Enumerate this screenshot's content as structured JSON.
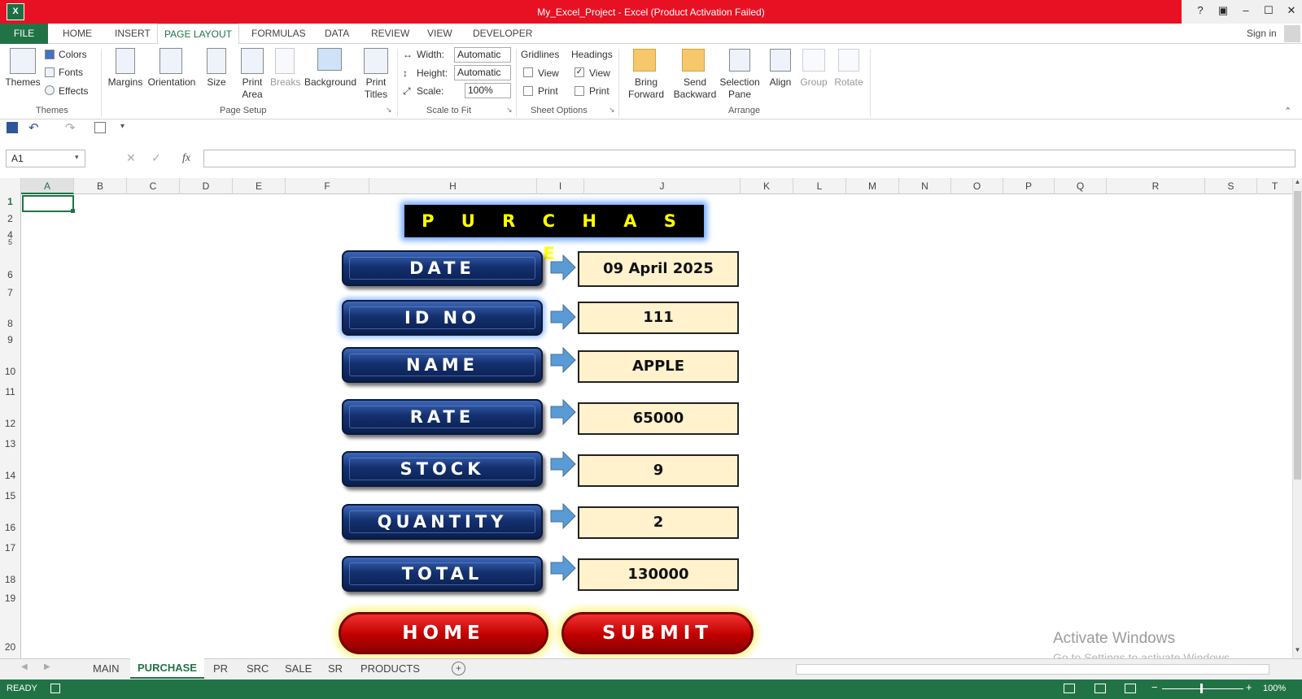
{
  "window": {
    "title": "My_Excel_Project -  Excel (Product Activation Failed)",
    "help": "?",
    "sign_in": "Sign in"
  },
  "ribbon_tabs": [
    "FILE",
    "HOME",
    "INSERT",
    "PAGE LAYOUT",
    "FORMULAS",
    "DATA",
    "REVIEW",
    "VIEW",
    "DEVELOPER"
  ],
  "ribbon": {
    "themes": {
      "themes": "Themes",
      "colors": "Colors",
      "fonts": "Fonts",
      "effects": "Effects",
      "group": "Themes"
    },
    "page_setup": {
      "margins": "Margins",
      "orientation": "Orientation",
      "size": "Size",
      "print_area": [
        "Print",
        "Area"
      ],
      "breaks": "Breaks",
      "background": "Background",
      "print_titles": [
        "Print",
        "Titles"
      ],
      "group": "Page Setup"
    },
    "scale_to_fit": {
      "width_label": "Width:",
      "width_value": "Automatic",
      "height_label": "Height:",
      "height_value": "Automatic",
      "scale_label": "Scale:",
      "scale_value": "100%",
      "group": "Scale to Fit"
    },
    "sheet_options": {
      "gridlines": "Gridlines",
      "headings": "Headings",
      "view": "View",
      "print": "Print",
      "group": "Sheet Options"
    },
    "arrange": {
      "bring_forward": [
        "Bring",
        "Forward"
      ],
      "send_backward": [
        "Send",
        "Backward"
      ],
      "selection_pane": [
        "Selection",
        "Pane"
      ],
      "align": "Align",
      "group_btn": "Group",
      "rotate": "Rotate",
      "group": "Arrange"
    }
  },
  "formula_bar": {
    "name_box": "A1",
    "fx": "fx",
    "value": ""
  },
  "columns": [
    "A",
    "B",
    "C",
    "D",
    "E",
    "F",
    "H",
    "I",
    "J",
    "K",
    "L",
    "M",
    "N",
    "O",
    "P",
    "Q",
    "R",
    "S",
    "T"
  ],
  "rows": [
    "1",
    "2",
    "4",
    "5",
    "6",
    "7",
    "8",
    "9",
    "10",
    "11",
    "12",
    "13",
    "14",
    "15",
    "16",
    "17",
    "18",
    "19",
    "20"
  ],
  "form": {
    "banner": "P U R C H A S E",
    "fields": [
      {
        "label": "DATE",
        "value": "09 April 2025"
      },
      {
        "label": "ID   NO",
        "value": "111"
      },
      {
        "label": "NAME",
        "value": "APPLE"
      },
      {
        "label": "RATE",
        "value": "65000"
      },
      {
        "label": "STOCK",
        "value": "9"
      },
      {
        "label": "QUANTITY",
        "value": "2"
      },
      {
        "label": "TOTAL",
        "value": "130000"
      }
    ],
    "home_button": "HOME",
    "submit_button": "SUBMIT"
  },
  "sheet_tabs": [
    "MAIN",
    "PURCHASE",
    "PR",
    "SRC",
    "SALE",
    "SR",
    "PRODUCTS"
  ],
  "active_sheet": "PURCHASE",
  "status": {
    "mode": "READY",
    "zoom": "100%"
  },
  "watermark": {
    "line1": "Activate Windows",
    "line2": "Go to Settings to activate Windows."
  },
  "colors": {
    "excel_green": "#217346",
    "title_red": "#e81123",
    "label_blue": "#14306f",
    "value_fill": "#fff2cc",
    "banner_text": "#ffff00",
    "button_red": "#c00000"
  }
}
